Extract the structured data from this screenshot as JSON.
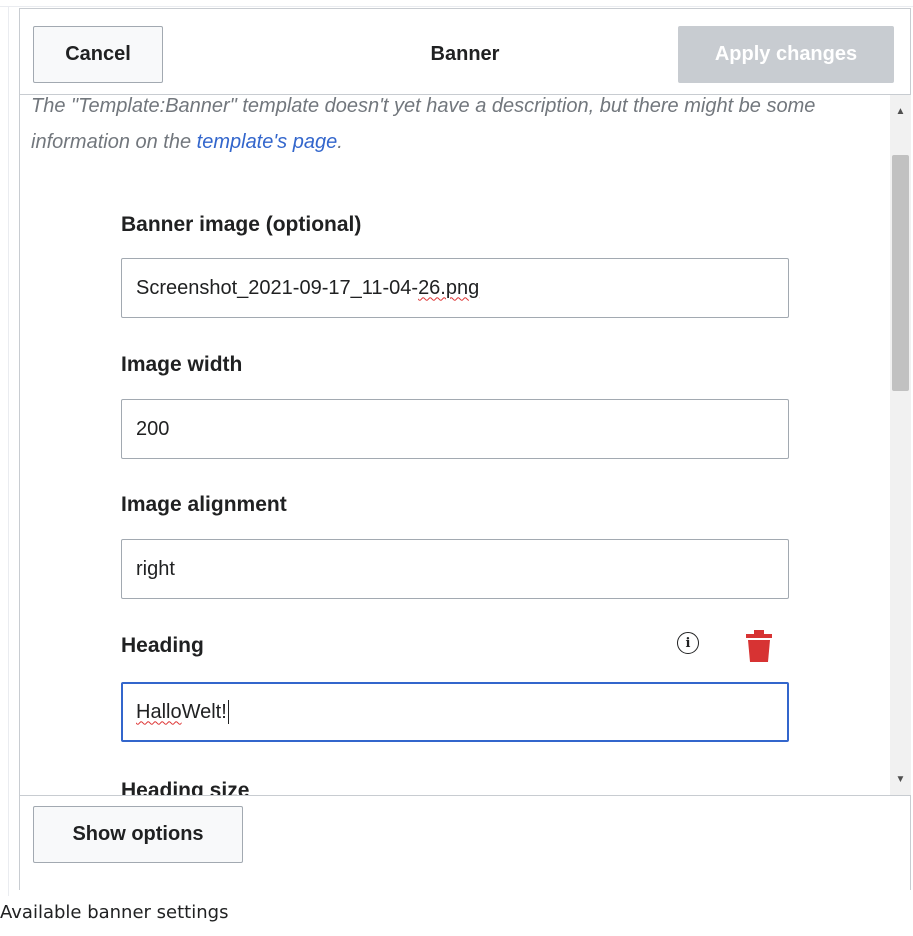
{
  "dialog": {
    "title": "Banner",
    "cancel_label": "Cancel",
    "apply_label": "Apply changes",
    "show_options_label": "Show options"
  },
  "description": {
    "text_before": "The \"Template:Banner\" template doesn't yet have a description, but there might be some information on the ",
    "link_text": "template's page",
    "text_after": "."
  },
  "fields": {
    "banner_image": {
      "label": "Banner image (optional)",
      "value": "Screenshot_2021-09-17_11-04-26.png",
      "value_prefix": "Screenshot_2021-09-17_11-04-",
      "value_misspelled": "26.png"
    },
    "image_width": {
      "label": "Image width",
      "value": "200"
    },
    "image_alignment": {
      "label": "Image alignment",
      "value": "right"
    },
    "heading": {
      "label": "Heading",
      "value": "Hallo Welt!",
      "value_misspelled": "Hallo",
      "value_rest": " Welt!"
    },
    "heading_size": {
      "label": "Heading size"
    }
  },
  "icons": {
    "info": "info-icon",
    "delete": "trash-icon",
    "delete_color": "#d73333",
    "info_glyph": "i"
  },
  "colors": {
    "link": "#3366cc",
    "focus_border": "#3366cc",
    "apply_disabled_bg": "#c8ccd1"
  },
  "caption": "Available banner settings"
}
